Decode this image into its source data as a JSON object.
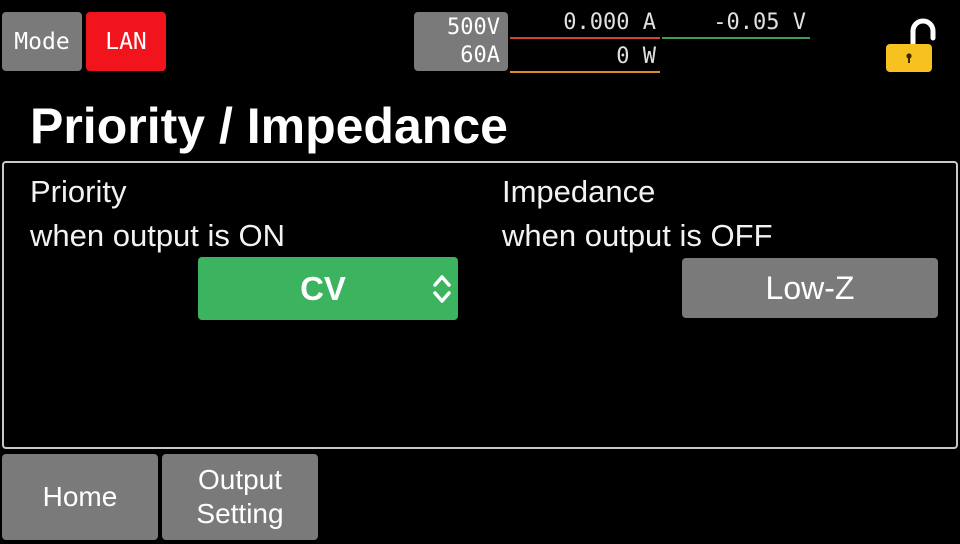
{
  "status_bar": {
    "mode_label": "Mode",
    "lan_label": "LAN",
    "rating_voltage": "500V",
    "rating_current": "60A",
    "current": "0.000",
    "current_unit": "A",
    "voltage": "-0.05",
    "voltage_unit": "V",
    "power": "0",
    "power_unit": "W",
    "lock_icon": "lock-unlocked-icon"
  },
  "page": {
    "title": "Priority / Impedance"
  },
  "priority": {
    "label_line1": "Priority",
    "label_line2": "when output is ON",
    "value": "CV"
  },
  "impedance": {
    "label_line1": "Impedance",
    "label_line2": "when output is OFF",
    "value": "Low-Z"
  },
  "bottom_bar": {
    "home_label": "Home",
    "output_setting_line1": "Output",
    "output_setting_line2": "Setting"
  },
  "colors": {
    "lan_active": "#f1141c",
    "priority_select": "#3cb35e",
    "button_gray": "#7a7a7a",
    "lock": "#f7c21f",
    "current_underline": "#d3422f",
    "voltage_underline": "#3e9b58",
    "power_underline": "#e08a2a"
  }
}
